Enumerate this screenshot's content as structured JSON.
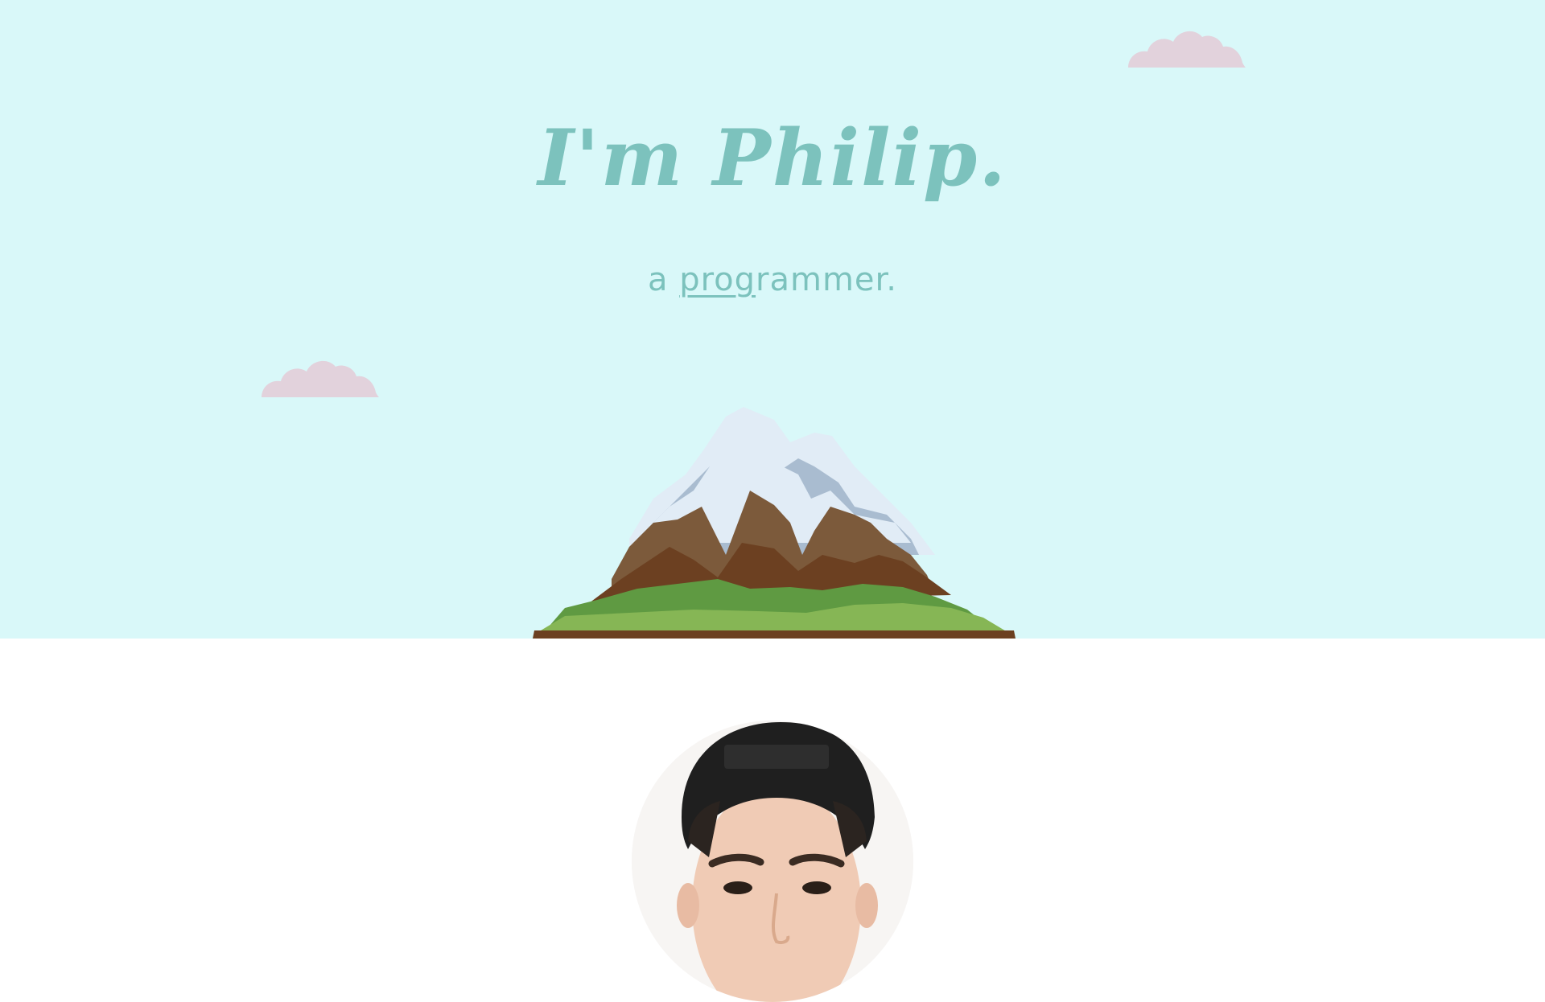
{
  "hero": {
    "title": "I'm Philip.",
    "subtitle_prefix": "a ",
    "subtitle_underlined": "prog",
    "subtitle_rest": "rammer.",
    "background_color": "#d9f8f9",
    "text_color": "#7cc2bd"
  },
  "clouds": {
    "color": "#e2d2dc"
  },
  "icons": {
    "mountain": "mountain-illustration",
    "cloud": "cloud-icon",
    "avatar": "profile-photo"
  }
}
